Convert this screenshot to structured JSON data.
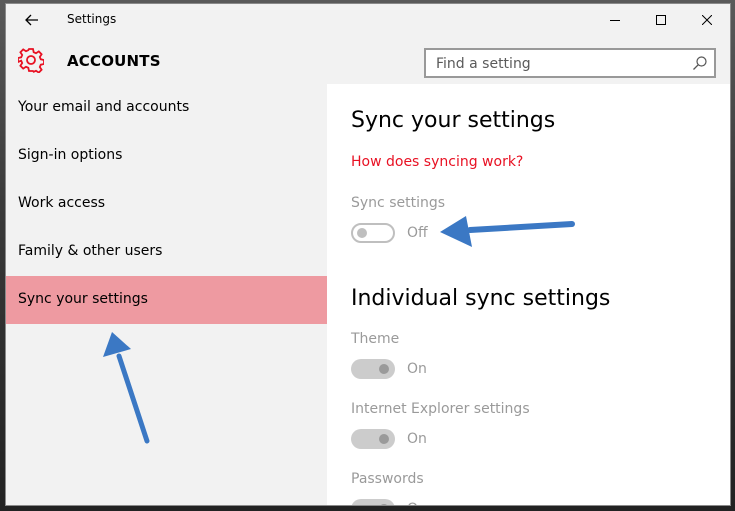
{
  "window": {
    "title": "Settings"
  },
  "header": {
    "title": "ACCOUNTS",
    "search_placeholder": "Find a setting"
  },
  "sidebar": {
    "items": [
      {
        "label": "Your email and accounts",
        "selected": false
      },
      {
        "label": "Sign-in options",
        "selected": false
      },
      {
        "label": "Work access",
        "selected": false
      },
      {
        "label": "Family & other users",
        "selected": false
      },
      {
        "label": "Sync your settings",
        "selected": true
      }
    ]
  },
  "content": {
    "title": "Sync your settings",
    "link": "How does syncing work?",
    "sync_settings": {
      "label": "Sync settings",
      "state": "Off"
    },
    "individual_title": "Individual sync settings",
    "individual": [
      {
        "label": "Theme",
        "state": "On"
      },
      {
        "label": "Internet Explorer settings",
        "state": "On"
      },
      {
        "label": "Passwords",
        "state": "On"
      }
    ]
  },
  "colors": {
    "accent": "#e81123",
    "selected_nav": "#ee9aa1",
    "arrow": "#3b78c4"
  }
}
